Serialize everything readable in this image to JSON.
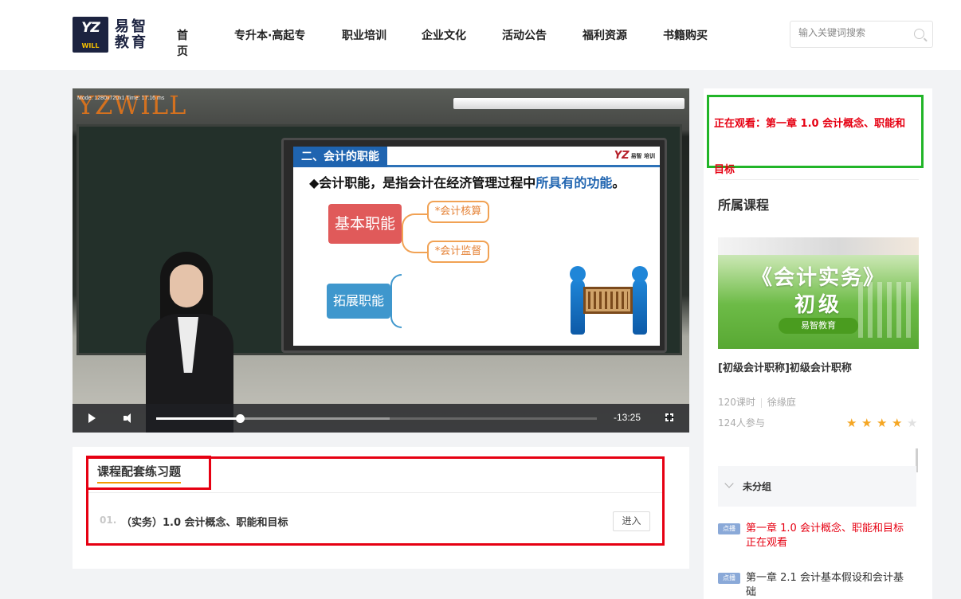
{
  "header": {
    "logo_mark": "YZ",
    "logo_mark_sub": "WILL",
    "logo_text_line1": "易智",
    "logo_text_line2": "教育",
    "nav": [
      "首页",
      "专升本·高起专",
      "职业培训",
      "企业文化",
      "活动公告",
      "福利资源",
      "书籍购买"
    ],
    "search_placeholder": "输入关键词搜索"
  },
  "video": {
    "watermark": "YZWILL",
    "debug_text": "Mode: 1280x720x1 Time: 17.16 ms",
    "slide": {
      "heading": "二、会计的职能",
      "logo": "YZ",
      "logo_sub": "易智\n培训",
      "bullet_prefix": "◆会计职能，是指会计在经济管理过程中",
      "bullet_highlight": "所具有的功能",
      "bullet_suffix": "。",
      "basic": "基本职能",
      "sub1": "*会计核算",
      "sub2": "*会计监督",
      "extended": "拓展职能"
    },
    "player": {
      "time_remaining": "-13:25",
      "progress_fraction": 0.19,
      "buffer_fraction": 0.53
    }
  },
  "exercise": {
    "title": "课程配套练习题",
    "items": [
      {
        "num": "01.",
        "label": "（实务）1.0 会计概念、职能和目标",
        "button": "进入"
      }
    ]
  },
  "sidebar": {
    "now_watching": "正在观看：第一章 1.0 会计概念、职能和目标",
    "section_title": "所属课程",
    "cover": {
      "title": "《会计实务》",
      "level": "初级",
      "brand": "易智教育"
    },
    "course_name": "[初级会计职称]初级会计职称",
    "lessons_count": "120课时",
    "teacher": "徐缘庭",
    "participants": "124人参与",
    "rating": 4,
    "rating_max": 5,
    "group_label": "未分组",
    "lessons": [
      {
        "tag": "点播",
        "text": "第一章 1.0 会计概念、职能和目标 正在观看",
        "active": true
      },
      {
        "tag": "点播",
        "text": "第一章 2.1 会计基本假设和会计基础",
        "active": false
      }
    ]
  },
  "colors": {
    "highlight_red": "#e60012",
    "highlight_green": "#21b528",
    "star": "#f5a623",
    "nav_text": "#222222"
  }
}
